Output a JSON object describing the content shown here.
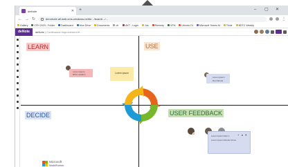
{
  "browser": {
    "tab_title": "dethóte",
    "url": "dennhote.all.web.cms.windows.net/b/.../board/.../..."
  },
  "bookmarks": [
    {
      "label": "Gallery",
      "color": "#f2b400"
    },
    {
      "label": "CFH 2023 - Folder",
      "color": "#2e7d32"
    },
    {
      "label": "Dashboard",
      "color": "#1565c0"
    },
    {
      "label": "Mon Drive",
      "color": "#1a73e8"
    },
    {
      "label": "Documents",
      "color": "#f9ab00"
    },
    {
      "label": "ch.",
      "color": "#9e9e9e"
    },
    {
      "label": "AKT - Login",
      "color": "#c62828"
    },
    {
      "label": "Jos",
      "color": "#f2b400"
    },
    {
      "label": "Remedy",
      "color": "#e64a19"
    },
    {
      "label": "VPN",
      "color": "#2e7d32"
    },
    {
      "label": "Ubuntu OI",
      "color": "#e95420"
    },
    {
      "label": "Microsoft Teams M",
      "color": "#5b5fc7"
    },
    {
      "label": "Trixie",
      "color": "#f2b400"
    },
    {
      "label": "BDTC Weekly",
      "color": "#f2b400"
    }
  ],
  "app": {
    "name": "deNote",
    "board_name": "deNote",
    "board_subtitle": "| Continuous Improvement ▾"
  },
  "quadrants": {
    "learn": "LEARN",
    "use": "USE",
    "decide": "DECIDE",
    "feedback": "USER FEEDBACK"
  },
  "stickies": {
    "yellow_text": "Lorem Ipsum",
    "red_card": {
      "line1": "Lorem ipsum",
      "line2": "DFG Location"
    },
    "blue_card1": {
      "line1": "Lorem Ipsum",
      "line2": "Dert Words"
    },
    "blue_card2": {
      "line1": "Lorem Ipsum Dert 1",
      "line2": "Lorem Ipsum Dorsal Intime"
    },
    "card_tools": "+ ◂ ✕"
  },
  "logo": {
    "line1": "Microsoft",
    "line2": "ModelFormer"
  },
  "icons": {
    "cycle": "cycle-arrows-icon",
    "rail": [
      "pointer-icon",
      "pen-icon",
      "sticky-icon",
      "shape-icon",
      "text-icon",
      "image-icon",
      "template-icon",
      "grid-icon",
      "comment-icon",
      "vote-icon",
      "timer-icon",
      "settings-icon"
    ]
  },
  "colors": {
    "brand": "#5b2d91",
    "learn_bg": "#f7c9c9",
    "use_bg": "#fde4cf",
    "decide_bg": "#d7e3f7",
    "feedback_bg": "#c6e0b4"
  }
}
